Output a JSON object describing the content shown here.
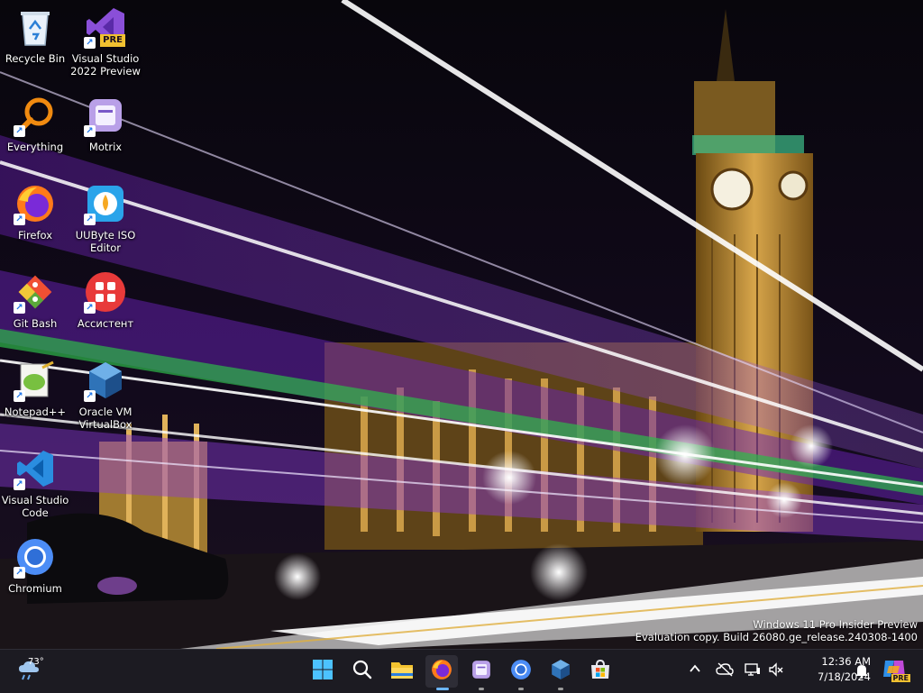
{
  "desktop": {
    "icons": [
      {
        "name": "recycle-bin",
        "label": "Recycle Bin",
        "icon": "recycle-bin-icon",
        "shortcut": false
      },
      {
        "name": "visual-studio-2022-preview",
        "label": "Visual Studio 2022 Preview",
        "icon": "visual-studio-preview-icon",
        "badge": "PRE",
        "shortcut": true
      },
      {
        "name": "everything",
        "label": "Everything",
        "icon": "magnifier-icon",
        "shortcut": true
      },
      {
        "name": "motrix",
        "label": "Motrix",
        "icon": "motrix-icon",
        "shortcut": true
      },
      {
        "name": "firefox",
        "label": "Firefox",
        "icon": "firefox-icon",
        "shortcut": true
      },
      {
        "name": "uubyte-iso-editor",
        "label": "UUByte ISO Editor",
        "icon": "uubyte-icon",
        "shortcut": true
      },
      {
        "name": "git-bash",
        "label": "Git Bash",
        "icon": "git-icon",
        "shortcut": true
      },
      {
        "name": "assistant",
        "label": "Ассистент",
        "icon": "assistant-icon",
        "shortcut": true
      },
      {
        "name": "notepad-plus-plus",
        "label": "Notepad++",
        "icon": "notepad-plus-plus-icon",
        "shortcut": true
      },
      {
        "name": "oracle-vm-virtualbox",
        "label": "Oracle VM VirtualBox",
        "icon": "virtualbox-icon",
        "shortcut": true
      },
      {
        "name": "visual-studio-code",
        "label": "Visual Studio Code",
        "icon": "vscode-icon",
        "shortcut": true
      },
      {
        "name": "chromium",
        "label": "Chromium",
        "icon": "chromium-icon",
        "shortcut": true
      }
    ]
  },
  "watermark": {
    "line1": "Windows 11 Pro Insider Preview",
    "line2": "Evaluation copy. Build 26080.ge_release.240308-1400"
  },
  "taskbar": {
    "weather": {
      "temp": "73°",
      "icon": "weather-cloud-rain-icon"
    },
    "apps": [
      {
        "name": "start",
        "icon": "windows-start-icon"
      },
      {
        "name": "search",
        "icon": "search-icon"
      },
      {
        "name": "file-explorer",
        "icon": "folder-icon"
      },
      {
        "name": "firefox",
        "icon": "firefox-icon",
        "active": true
      },
      {
        "name": "motrix",
        "icon": "motrix-icon",
        "running": true
      },
      {
        "name": "chromium",
        "icon": "chromium-icon",
        "running": true
      },
      {
        "name": "virtualbox",
        "icon": "virtualbox-icon",
        "running": true
      },
      {
        "name": "microsoft-store",
        "icon": "store-icon"
      }
    ],
    "tray": {
      "chevron": "chevron-up-icon",
      "network": "cloud-offline-icon",
      "display": "display-icon",
      "volume": "volume-muted-icon"
    },
    "clock": {
      "time": "12:36 AM",
      "date": "7/18/2024"
    },
    "notification_icon": "bell-icon",
    "copilot_badge": "PRE"
  },
  "colors": {
    "taskbar_bg": "#1c1b22",
    "accent": "#6cb6ff",
    "purple_streak": "#7a2fd1",
    "green_streak": "#2eb84a"
  }
}
